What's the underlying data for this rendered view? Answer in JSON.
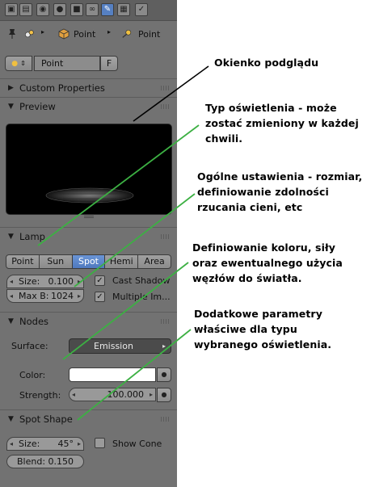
{
  "properties_panel": {
    "context_tabs": [
      {
        "icon": "render-icon",
        "glyph": "▣"
      },
      {
        "icon": "render-layers-icon",
        "glyph": "▤"
      },
      {
        "icon": "scene-icon",
        "glyph": "◉"
      },
      {
        "icon": "world-icon",
        "glyph": "●"
      },
      {
        "icon": "object-icon",
        "glyph": "■"
      },
      {
        "icon": "constraints-icon",
        "glyph": "∞"
      },
      {
        "icon": "lamp-data-icon",
        "glyph": "✎",
        "active": true
      },
      {
        "icon": "texture-icon",
        "glyph": "▦"
      },
      {
        "icon": "physics-icon",
        "glyph": "✓"
      }
    ],
    "breadcrumb": [
      "Point",
      "Point"
    ],
    "datablock": {
      "name": "Point",
      "fake_user": "F"
    },
    "sections": {
      "custom_properties": "Custom Properties",
      "preview": "Preview",
      "lamp": "Lamp",
      "nodes": "Nodes",
      "spot_shape": "Spot Shape"
    },
    "lamp": {
      "types": [
        "Point",
        "Sun",
        "Spot",
        "Hemi",
        "Area"
      ],
      "selected_type": "Spot",
      "size": {
        "label": "Size:",
        "value": "0.100"
      },
      "max_bounces": {
        "label": "Max B:",
        "value": "1024"
      },
      "cast_shadow": {
        "label": "Cast Shadow",
        "checked": true
      },
      "multiple_importance": {
        "label": "Multiple Im...",
        "checked": true
      }
    },
    "nodes": {
      "surface_label": "Surface:",
      "surface_value": "Emission",
      "color_label": "Color:",
      "color_value": "#ffffff",
      "strength_label": "Strength:",
      "strength_value": "100.000"
    },
    "spot_shape": {
      "size": {
        "label": "Size:",
        "value": "45°"
      },
      "blend": {
        "label": "Blend:",
        "value": "0.150"
      },
      "show_cone": {
        "label": "Show Cone",
        "checked": false
      }
    }
  },
  "annotations": {
    "preview_note": "Okienko podglądu",
    "type_note": "Typ oświetlenia - może zostać zmieniony w każdej chwili.",
    "general_note": "Ogólne ustawienia - rozmiar, definiowanie zdolności rzucania cieni, etc",
    "color_note": "Definiowanie koloru, siły oraz ewentualnego użycia węzłów do światła.",
    "extra_note": "Dodatkowe parametry właściwe dla typu wybranego oświetlenia.",
    "line_colors": {
      "preview": "#000000",
      "others": "#3cb043"
    }
  }
}
